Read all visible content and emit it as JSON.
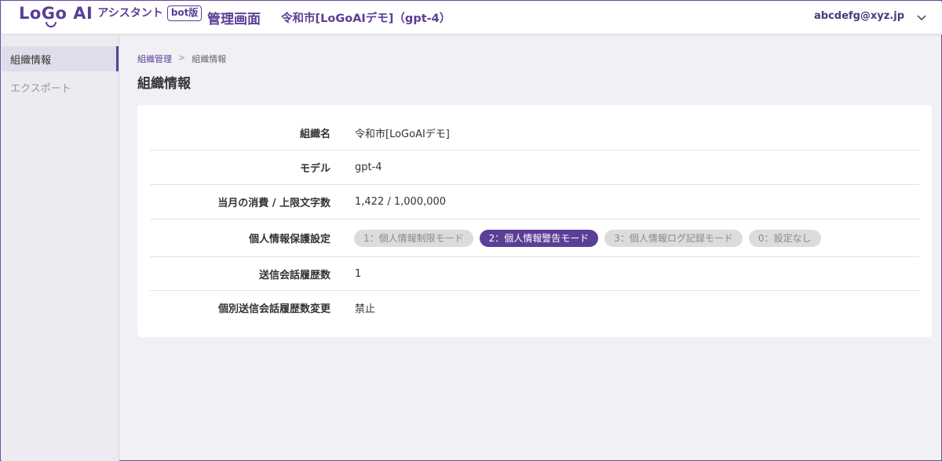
{
  "header": {
    "logo_text": "LoGo AI",
    "logo_sub": "アシスタント",
    "logo_badge": "bot版",
    "admin_title": "管理画面",
    "org_title": "令和市[LoGoAIデモ]（gpt-4）",
    "user_email": "abcdefg@xyz.jp",
    "chevron_icon": "chevron-down-icon"
  },
  "sidebar": {
    "items": [
      {
        "label": "組織情報",
        "active": true
      },
      {
        "label": "エクスポート",
        "active": false
      }
    ]
  },
  "breadcrumb": {
    "parent": "組織管理",
    "separator": ">",
    "current": "組織情報"
  },
  "page": {
    "title": "組織情報"
  },
  "details": {
    "org_name": {
      "label": "組織名",
      "value": "令和市[LoGoAIデモ]"
    },
    "model": {
      "label": "モデル",
      "value": "gpt-4"
    },
    "usage": {
      "label": "当月の消費 / 上限文字数",
      "value": "1,422 / 1,000,000"
    },
    "privacy": {
      "label": "個人情報保護設定",
      "options": [
        "1：個人情報制限モード",
        "2：個人情報警告モード",
        "3：個人情報ログ記録モード",
        "0：設定なし"
      ],
      "selected_index": 1
    },
    "history_count": {
      "label": "送信会話履歴数",
      "value": "1"
    },
    "history_change": {
      "label": "個別送信会話履歴数変更",
      "value": "禁止"
    }
  },
  "colors": {
    "accent": "#5b3e96",
    "pill_inactive": "#dcdcdf",
    "background": "#f0f0f5"
  }
}
